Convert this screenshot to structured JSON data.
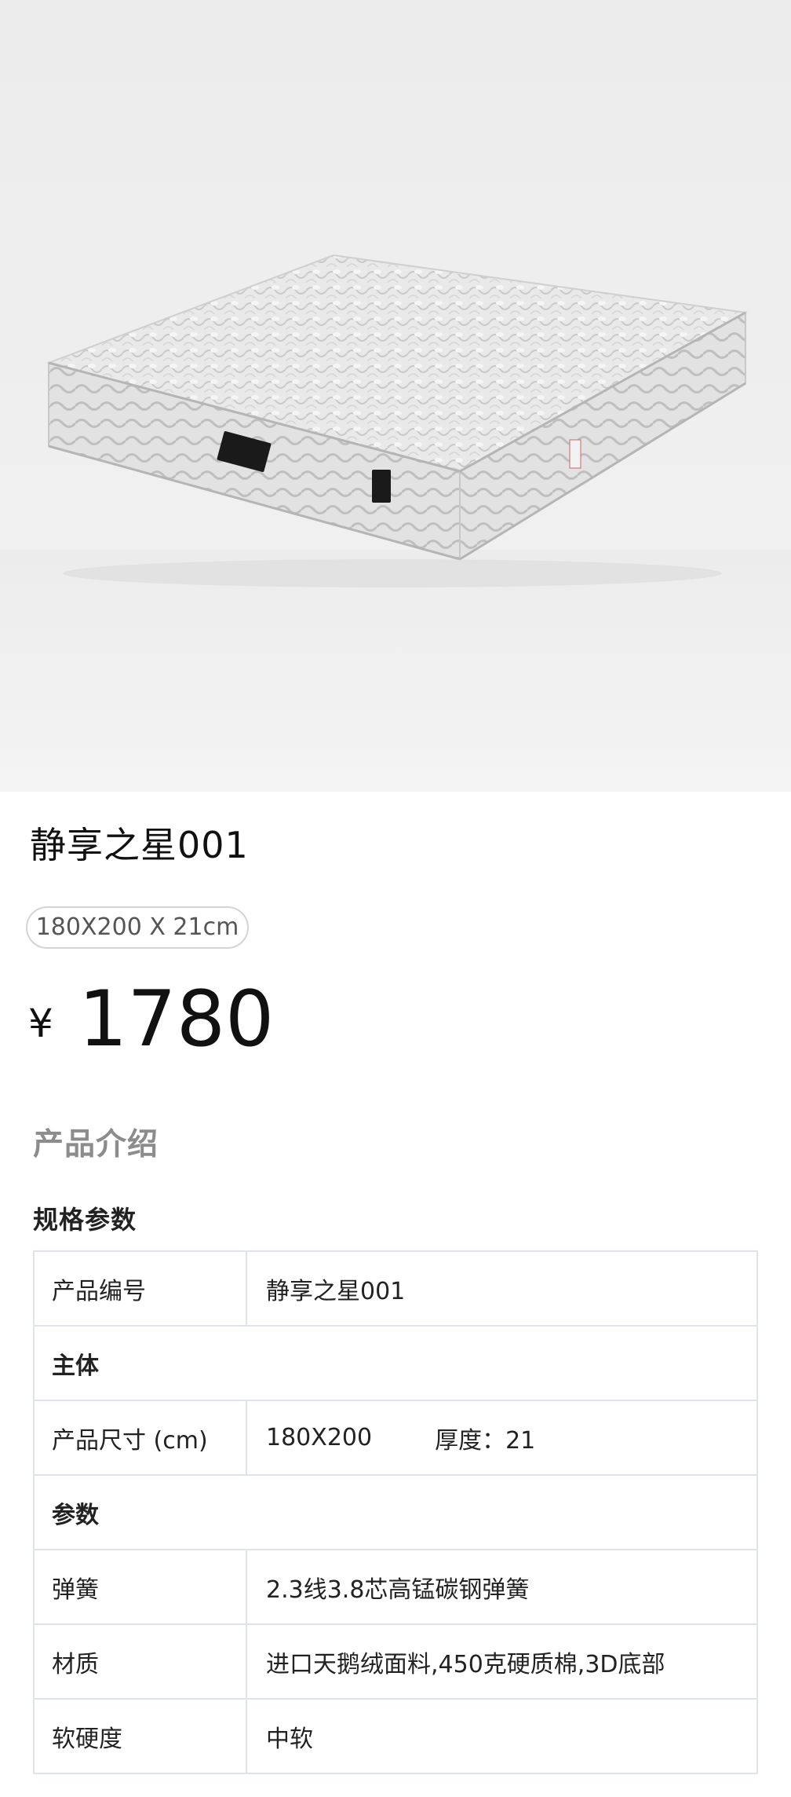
{
  "product": {
    "image_name": "mattress-photo",
    "name": "静享之星001",
    "size_tag": "180X200 X 21cm",
    "price_symbol": "¥",
    "price": "1780"
  },
  "intro": {
    "heading": "产品介绍",
    "spec_heading": "规格参数"
  },
  "table": {
    "code_label": "产品编号",
    "code_value": "静享之星001",
    "section_main": "主体",
    "size_label": "产品尺寸 (cm)",
    "size_value": "180X200",
    "thickness_value": "厚度：21",
    "section_params": "参数",
    "spring_label": "弹簧",
    "spring_value": "2.3线3.8芯高锰碳钢弹簧",
    "material_label": "材质",
    "material_value": "进口天鹅绒面料,450克硬质棉,3D底部",
    "firmness_label": "软硬度",
    "firmness_value": "中软"
  }
}
